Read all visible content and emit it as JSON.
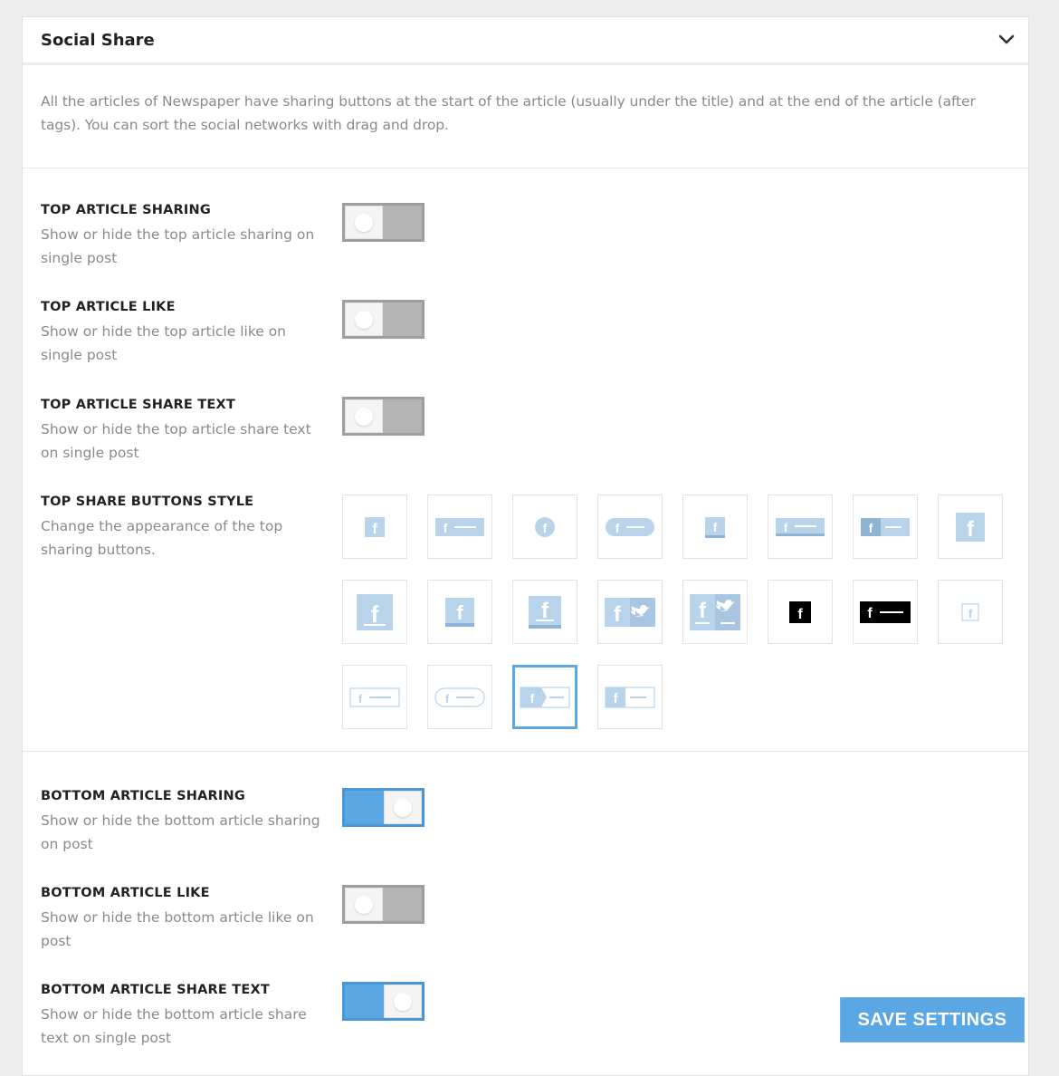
{
  "panel": {
    "title": "Social Share",
    "intro": "All the articles of Newspaper have sharing buttons at the start of the article (usually under the title) and at the end of the article (after tags). You can sort the social networks with drag and drop."
  },
  "settings": {
    "top_sharing": {
      "title": "TOP ARTICLE SHARING",
      "desc": "Show or hide the top article sharing on single post",
      "enabled": false
    },
    "top_like": {
      "title": "TOP ARTICLE LIKE",
      "desc": "Show or hide the top article like on single post",
      "enabled": false
    },
    "top_share_text": {
      "title": "TOP ARTICLE SHARE TEXT",
      "desc": "Show or hide the top article share text on single post",
      "enabled": false
    },
    "top_style": {
      "title": "TOP SHARE BUTTONS STYLE",
      "desc": "Change the appearance of the top sharing buttons.",
      "options": [
        "style-1",
        "style-2",
        "style-3",
        "style-4",
        "style-5",
        "style-6",
        "style-7",
        "style-8",
        "style-9",
        "style-10",
        "style-11",
        "style-12",
        "style-13",
        "style-14",
        "style-15",
        "style-16",
        "style-17",
        "style-18",
        "style-19",
        "style-20"
      ],
      "selected_index": 18
    },
    "bottom_sharing": {
      "title": "BOTTOM ARTICLE SHARING",
      "desc": "Show or hide the bottom article sharing on post",
      "enabled": true
    },
    "bottom_like": {
      "title": "BOTTOM ARTICLE LIKE",
      "desc": "Show or hide the bottom article like on post",
      "enabled": false
    },
    "bottom_share_text": {
      "title": "BOTTOM ARTICLE SHARE TEXT",
      "desc": "Show or hide the bottom article share text on single post",
      "enabled": true
    }
  },
  "actions": {
    "save_label": "SAVE SETTINGS"
  },
  "colors": {
    "accent": "#5ba7e3",
    "icon_light": "#b9d4ea",
    "toggle_off": "#b4b4b4"
  }
}
